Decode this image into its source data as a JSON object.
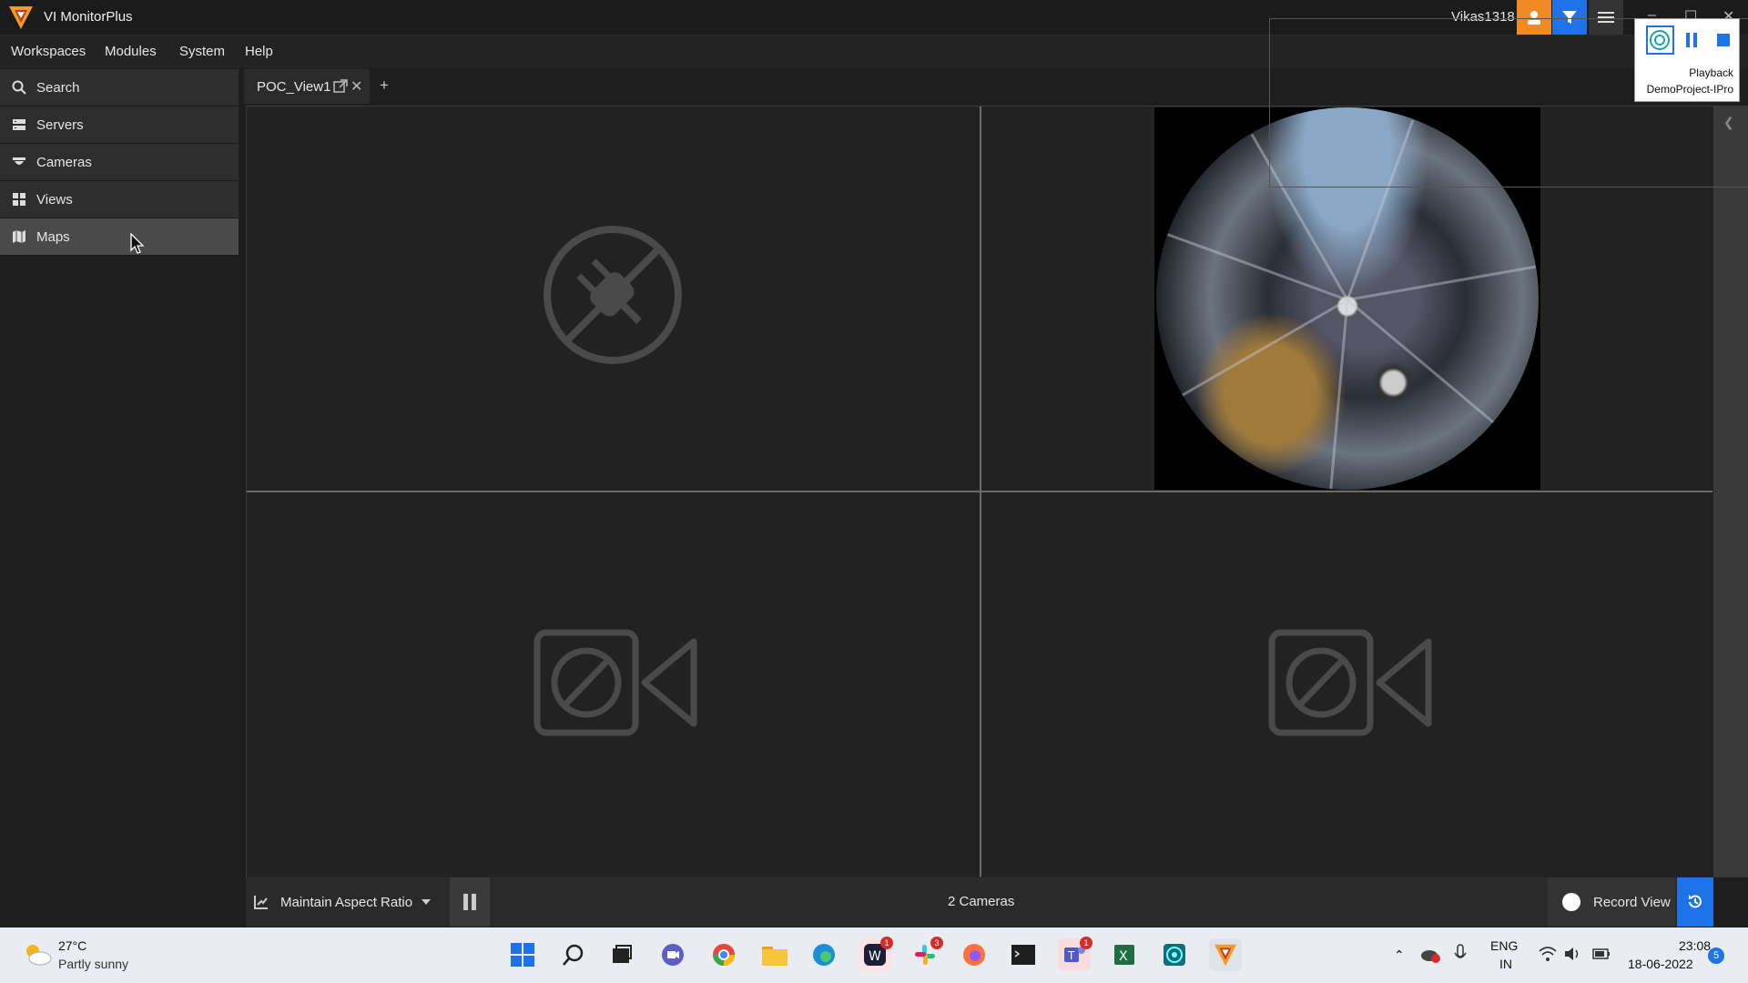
{
  "app": {
    "title": "VI MonitorPlus",
    "user": "Vikas1318"
  },
  "menu": [
    "Workspaces",
    "Modules",
    "System",
    "Help"
  ],
  "sidebar": {
    "items": [
      {
        "label": "Search",
        "icon": "search-icon"
      },
      {
        "label": "Servers",
        "icon": "servers-icon"
      },
      {
        "label": "Cameras",
        "icon": "camera-dome-icon"
      },
      {
        "label": "Views",
        "icon": "grid-icon"
      },
      {
        "label": "Maps",
        "icon": "map-icon"
      }
    ],
    "active": "Maps"
  },
  "tabs": [
    {
      "label": "POC_View1"
    }
  ],
  "tab_add_label": "+",
  "grid": {
    "cells": [
      {
        "state": "disconnected",
        "icon": "unplugged-icon"
      },
      {
        "state": "live",
        "camera": "fisheye"
      },
      {
        "state": "no-camera",
        "icon": "camera-disabled-icon"
      },
      {
        "state": "no-camera",
        "icon": "camera-disabled-icon"
      }
    ]
  },
  "bottombar": {
    "aspect_label": "Maintain Aspect Ratio",
    "camera_count": "2 Cameras",
    "record_label": "Record View"
  },
  "popup": {
    "line1": "Playback",
    "line2": "DemoProject-IPro"
  },
  "taskbar": {
    "weather_temp": "27°C",
    "weather_desc": "Partly sunny",
    "badges": {
      "teams_chat": "",
      "webex": "1",
      "slack": "3",
      "teams": "1"
    },
    "lang1": "ENG",
    "lang2": "IN",
    "time": "23:08",
    "date": "18-06-2022",
    "notifications": "5"
  },
  "colors": {
    "accent_blue": "#1e73e8",
    "accent_orange": "#f08a24",
    "panel": "#2e2e2e",
    "active": "#4a4a4a"
  }
}
